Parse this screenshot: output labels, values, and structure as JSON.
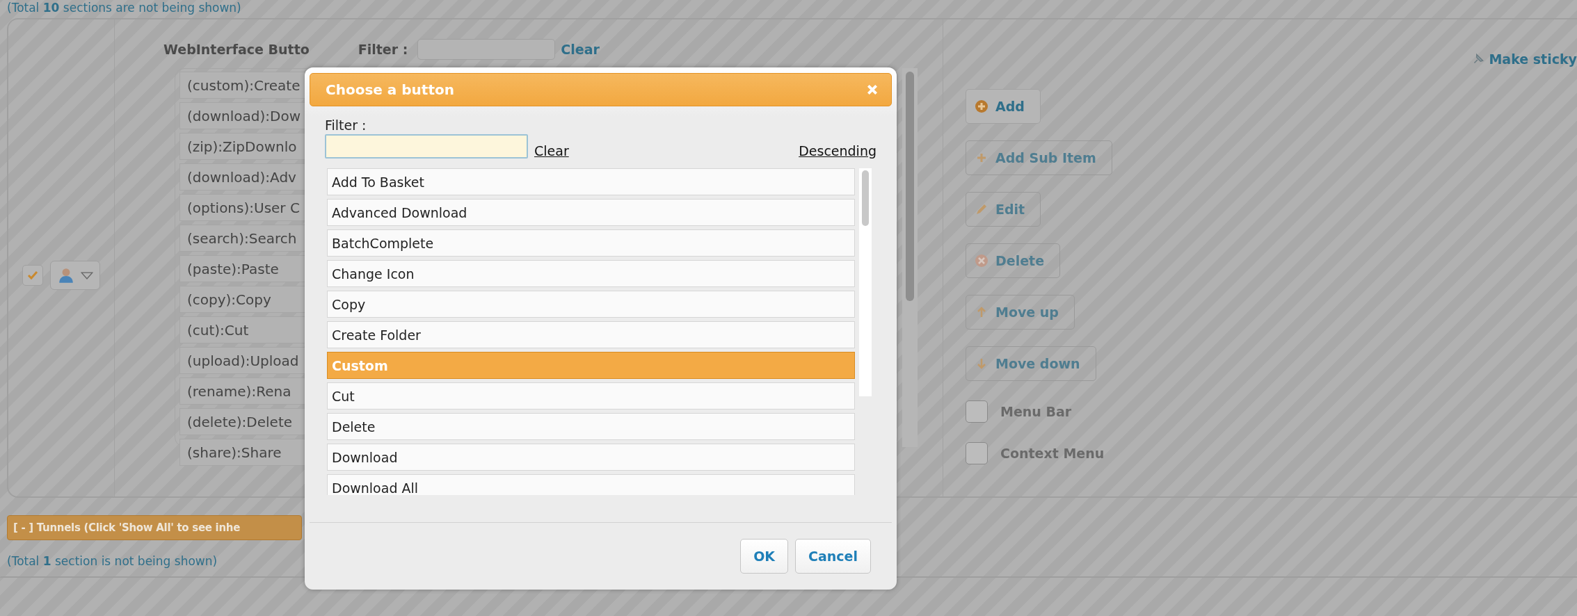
{
  "top_note": "(Total **10** sections are not being shown)",
  "panel": {
    "make_sticky": "Make sticky",
    "enabled_checkbox": {
      "checked": true
    },
    "title": "WebInterface Butto",
    "filter_label": "Filter :",
    "clear_link": "Clear",
    "items": [
      "(custom):Create",
      "(download):Dow",
      "(zip):ZipDownlo",
      "(download):Adv",
      "(options):User C",
      "(search):Search",
      "(paste):Paste",
      "(copy):Copy",
      "(cut):Cut",
      "(upload):Upload",
      "(rename):Rena",
      "(delete):Delete",
      "(share):Share"
    ],
    "actions": [
      {
        "label": "Add",
        "kind": "add",
        "disabled": false
      },
      {
        "label": "Add Sub Item",
        "kind": "plus",
        "disabled": true
      },
      {
        "label": "Edit",
        "kind": "edit",
        "disabled": true
      },
      {
        "label": "Delete",
        "kind": "delete",
        "disabled": true
      },
      {
        "label": "Move up",
        "kind": "up",
        "disabled": true
      },
      {
        "label": "Move down",
        "kind": "down",
        "disabled": true
      }
    ],
    "options": [
      {
        "label": "Menu Bar",
        "checked": false
      },
      {
        "label": "Context Menu",
        "checked": false
      }
    ]
  },
  "tunnels_header": "[ - ] Tunnels (Click 'Show All' to see inhe",
  "bottom_note": "(Total **1** section is not being shown)",
  "dialog": {
    "title": "Choose a button",
    "filter_label": "Filter :",
    "clear": "Clear",
    "sort": "Descending",
    "items": [
      {
        "label": "Add To Basket",
        "selected": false
      },
      {
        "label": "Advanced Download",
        "selected": false
      },
      {
        "label": "BatchComplete",
        "selected": false
      },
      {
        "label": "Change Icon",
        "selected": false
      },
      {
        "label": "Copy",
        "selected": false
      },
      {
        "label": "Create Folder",
        "selected": false
      },
      {
        "label": "Custom",
        "selected": true
      },
      {
        "label": "Cut",
        "selected": false
      },
      {
        "label": "Delete",
        "selected": false
      },
      {
        "label": "Download",
        "selected": false
      },
      {
        "label": "Download All",
        "selected": false
      }
    ],
    "buttons": [
      "OK",
      "Cancel"
    ]
  }
}
